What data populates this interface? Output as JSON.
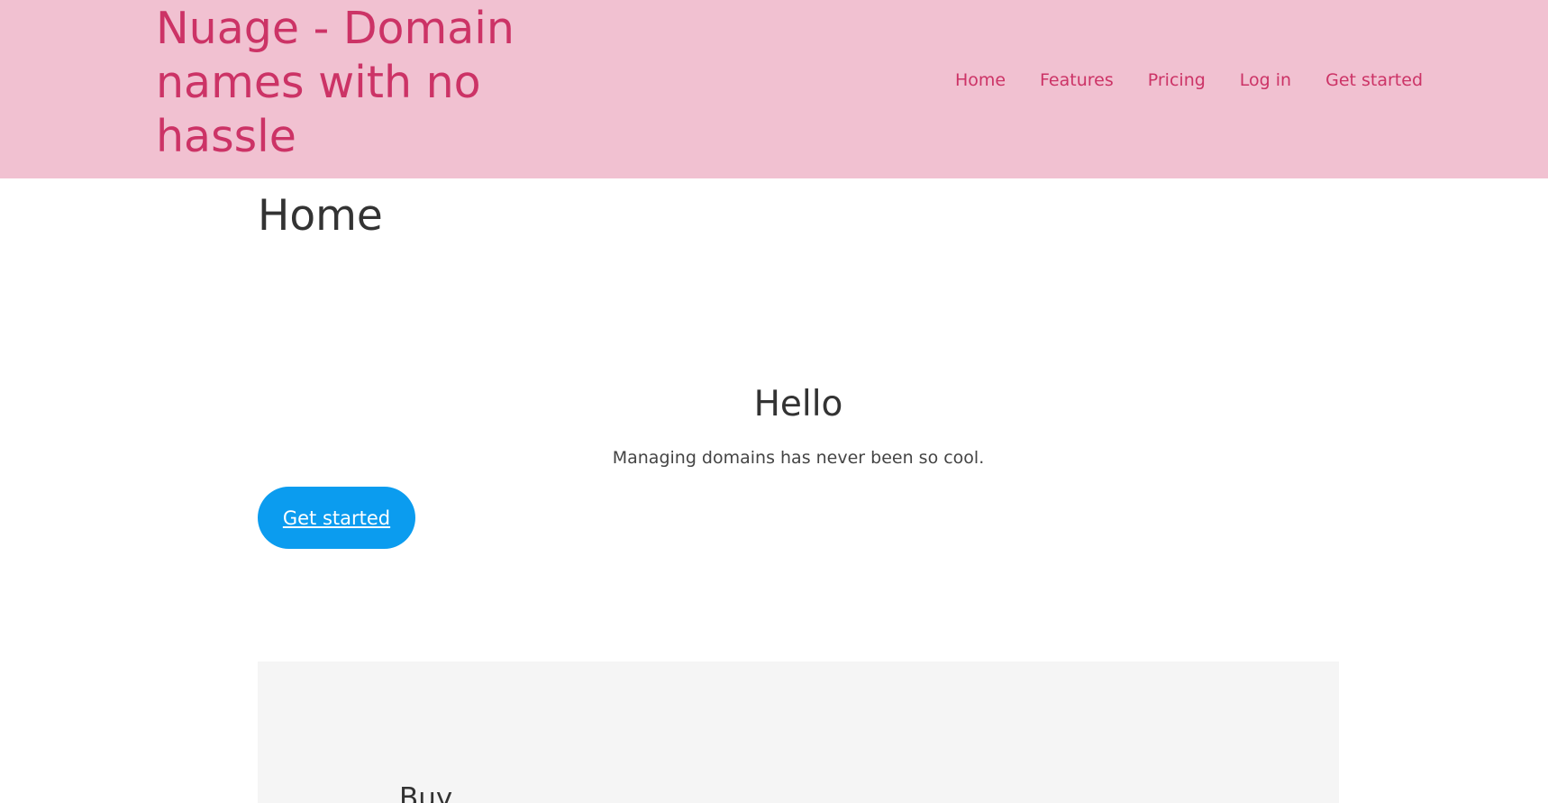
{
  "header": {
    "title": "Nuage - Domain names with no hassle",
    "nav": [
      {
        "label": "Home"
      },
      {
        "label": "Features"
      },
      {
        "label": "Pricing"
      },
      {
        "label": "Log in"
      },
      {
        "label": "Get started"
      }
    ]
  },
  "main": {
    "page_title": "Home",
    "hero": {
      "heading": "Hello",
      "text": "Managing domains has never been so cool.",
      "cta_label": "Get started"
    },
    "section": {
      "heading": "Buy"
    }
  },
  "colors": {
    "header_bg": "#f1c1d1",
    "brand": "#cc3366",
    "cta_bg": "#0b9cef",
    "panel_bg": "#f5f5f5"
  }
}
